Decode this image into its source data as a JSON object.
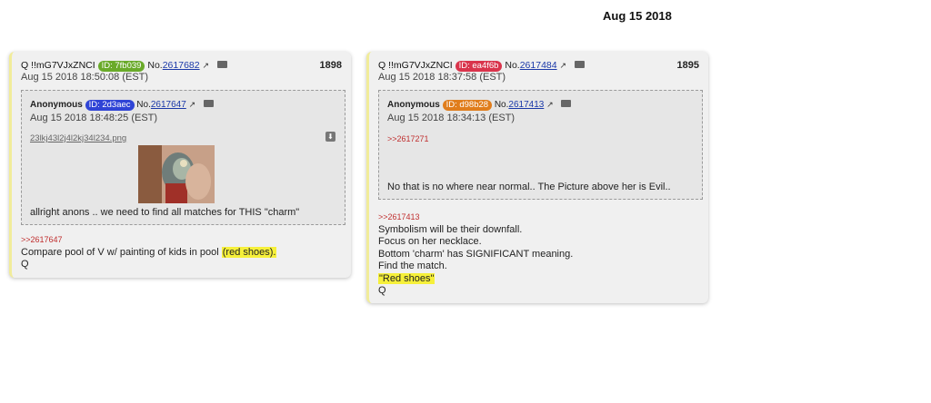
{
  "page_heading": "Aug 15 2018",
  "posts": [
    {
      "author": "Q",
      "tripcode": "!!mG7VJxZNCI",
      "id_label": "ID: 7fb039",
      "id_color": "#6aaa2a",
      "no_prefix": "No.",
      "post_no": "2617682",
      "number": "1898",
      "timestamp": "Aug 15 2018 18:50:08 (EST)",
      "quoted": {
        "author": "Anonymous",
        "id_label": "ID: 2d3aec",
        "id_color": "#2f44d6",
        "no_prefix": "No.",
        "post_no": "2617647",
        "timestamp": "Aug 15 2018 18:48:25 (EST)",
        "filename": "23lkj43l2j4l2kj34l234.png",
        "text": "allright anons .. we need to find all matches for THIS \"charm\""
      },
      "reply_ref": ">>2617647",
      "body_line1_plain": "Compare pool of V w/ painting of kids in pool ",
      "body_line1_highlight": "(red shoes).",
      "body_line2": "Q"
    },
    {
      "author": "Q",
      "tripcode": "!!mG7VJxZNCI",
      "id_label": "ID: ea4f6b",
      "id_color": "#d9344c",
      "no_prefix": "No.",
      "post_no": "2617484",
      "number": "1895",
      "timestamp": "Aug 15 2018 18:37:58 (EST)",
      "quoted": {
        "author": "Anonymous",
        "id_label": "ID: d98b28",
        "id_color": "#e07d1c",
        "no_prefix": "No.",
        "post_no": "2617413",
        "timestamp": "Aug 15 2018 18:34:13 (EST)",
        "reply_ref": ">>2617271",
        "text": "No that is no where near normal.. The Picture above her is Evil.."
      },
      "reply_ref": ">>2617413",
      "lines": [
        "Symbolism will be their downfall.",
        "Focus on her necklace.",
        "Bottom 'charm' has SIGNIFICANT meaning.",
        "Find the match."
      ],
      "highlight_line": "\"Red shoes\"",
      "sign": "Q"
    }
  ]
}
